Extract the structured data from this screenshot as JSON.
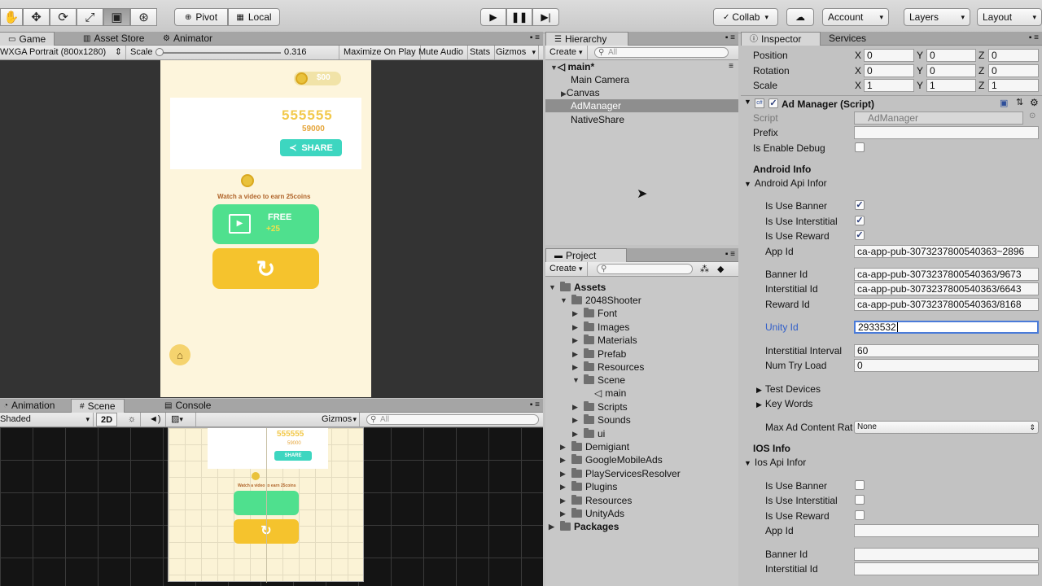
{
  "toolbar": {
    "pivot_label": "Pivot",
    "local_label": "Local",
    "collab_label": "Collab",
    "account_label": "Account",
    "layers_label": "Layers",
    "layout_label": "Layout"
  },
  "game_panel": {
    "tabs": [
      "Game",
      "Asset Store",
      "Animator"
    ],
    "resolution": "WXGA Portrait (800x1280)",
    "scale_label": "Scale",
    "scale_value": "0.316",
    "maximize_on_play": "Maximize On Play",
    "mute_audio": "Mute Audio",
    "stats": "Stats",
    "gizmos": "Gizmos",
    "game": {
      "coins": "$00",
      "score": "555555",
      "best": "59000",
      "share": "SHARE",
      "watch_text": "Watch a video to earn 25coins",
      "free_label": "FREE",
      "free_reward": "+25"
    }
  },
  "scene_panel": {
    "tabs": [
      "Animation",
      "Scene",
      "Console"
    ],
    "shading": "Shaded",
    "mode_2d": "2D",
    "gizmos": "Gizmos",
    "search_placeholder": "All",
    "scene": {
      "score": "555555",
      "best": "59000",
      "share": "SHARE",
      "watch_text": "Watch a video to earn 25coins"
    }
  },
  "hierarchy": {
    "tab": "Hierarchy",
    "create": "Create",
    "search_placeholder": "All",
    "scene_name": "main*",
    "items": [
      "Main Camera",
      "Canvas",
      "AdManager",
      "NativeShare"
    ]
  },
  "project": {
    "tab": "Project",
    "create": "Create",
    "tree": {
      "assets": "Assets",
      "shooter": "2048Shooter",
      "font": "Font",
      "images": "Images",
      "materials": "Materials",
      "prefab": "Prefab",
      "resources": "Resources",
      "scene": "Scene",
      "main": "main",
      "scripts": "Scripts",
      "sounds": "Sounds",
      "ui": "ui",
      "demigiant": "Demigiant",
      "googlemobileads": "GoogleMobileAds",
      "playservices": "PlayServicesResolver",
      "plugins": "Plugins",
      "resources2": "Resources",
      "unityads": "UnityAds",
      "packages": "Packages"
    }
  },
  "inspector": {
    "tabs": [
      "Inspector",
      "Services"
    ],
    "transform": {
      "position_label": "Position",
      "rotation_label": "Rotation",
      "scale_label": "Scale",
      "x": "X",
      "y": "Y",
      "z": "Z",
      "position": [
        "0",
        "0",
        "0"
      ],
      "rotation": [
        "0",
        "0",
        "0"
      ],
      "scale": [
        "1",
        "1",
        "1"
      ]
    },
    "component_title": "Ad Manager (Script)",
    "script_label": "Script",
    "script_value": "AdManager",
    "prefix_label": "Prefix",
    "debug_label": "Is Enable Debug",
    "android_info": "Android Info",
    "android_api": "Android Api Infor",
    "android": {
      "use_banner": "Is Use Banner",
      "use_interstitial": "Is Use Interstitial",
      "use_reward": "Is Use Reward",
      "app_id_label": "App Id",
      "app_id": "ca-app-pub-3073237800540363~2896",
      "banner_id_label": "Banner Id",
      "banner_id": "ca-app-pub-3073237800540363/9673",
      "interstitial_id_label": "Interstitial Id",
      "interstitial_id": "ca-app-pub-3073237800540363/6643",
      "reward_id_label": "Reward Id",
      "reward_id": "ca-app-pub-3073237800540363/8168",
      "unity_id_label": "Unity Id",
      "unity_id": "2933532",
      "interstitial_interval_label": "Interstitial Interval",
      "interstitial_interval": "60",
      "num_try_load_label": "Num Try Load",
      "num_try_load": "0",
      "test_devices": "Test Devices",
      "key_words": "Key Words",
      "max_ad_label": "Max Ad Content Rat",
      "max_ad_value": "None"
    },
    "ios_info": "IOS Info",
    "ios_api": "Ios Api Infor",
    "ios": {
      "use_banner": "Is Use Banner",
      "use_interstitial": "Is Use Interstitial",
      "use_reward": "Is Use Reward",
      "app_id_label": "App Id",
      "banner_id_label": "Banner Id",
      "interstitial_id_label": "Interstitial Id"
    }
  }
}
